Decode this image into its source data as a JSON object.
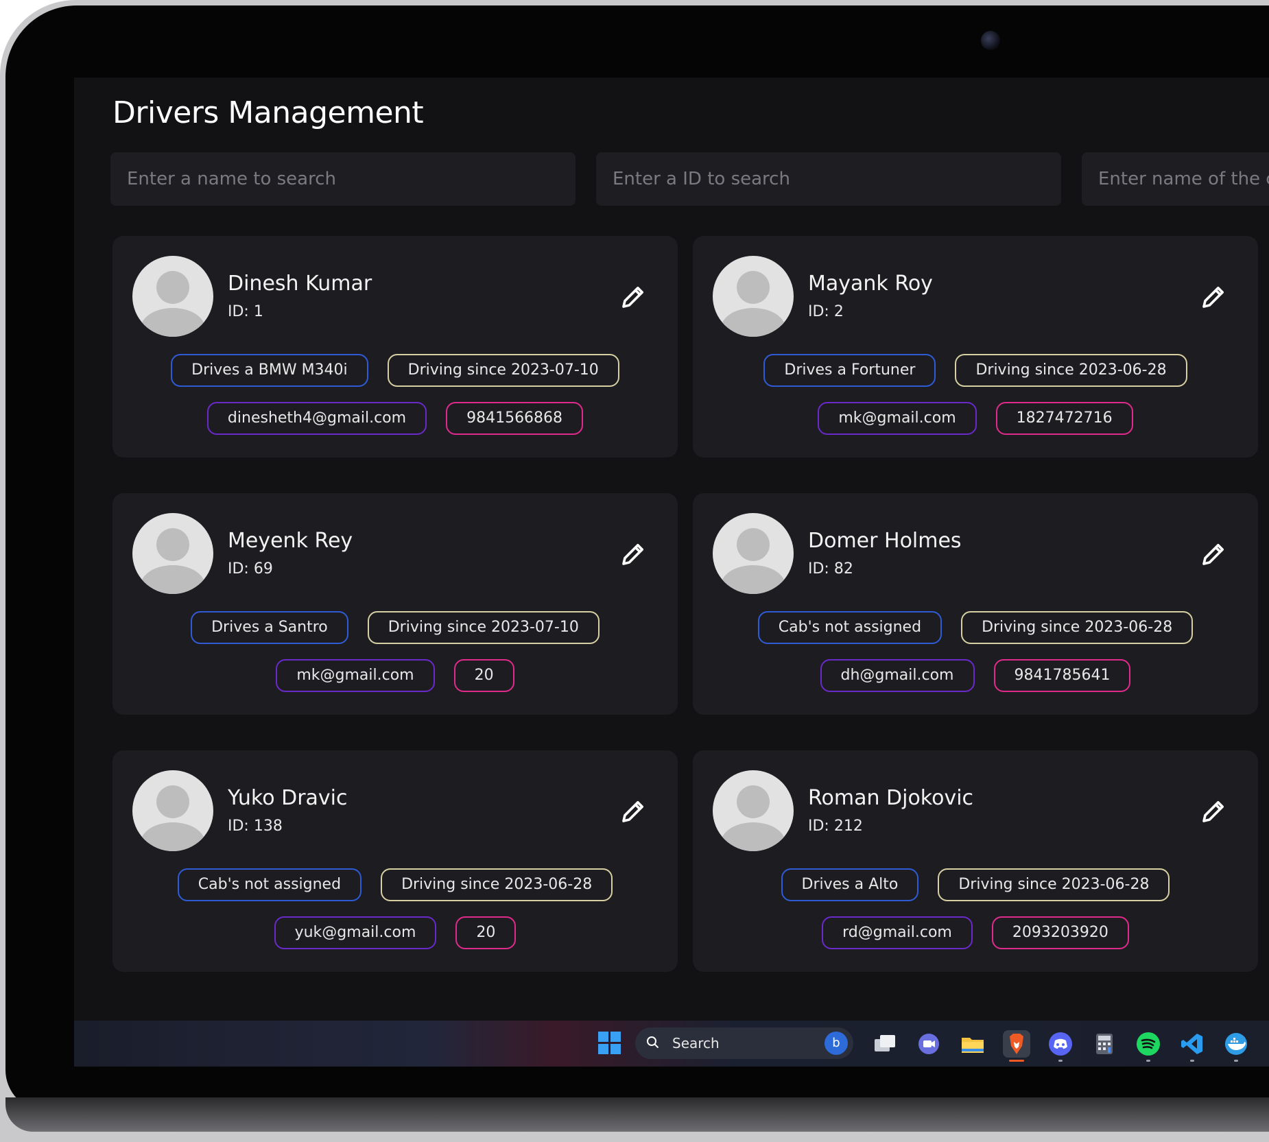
{
  "page": {
    "title": "Drivers Management"
  },
  "search": {
    "name_placeholder": "Enter a name to search",
    "id_placeholder": "Enter a ID to search",
    "cab_placeholder": "Enter name of the cab"
  },
  "drivers": [
    {
      "name": "Dinesh Kumar",
      "id": "ID: 1",
      "cab": "Drives a BMW M340i",
      "since": "Driving since 2023-07-10",
      "email": "dinesheth4@gmail.com",
      "phone": "9841566868"
    },
    {
      "name": "Mayank Roy",
      "id": "ID: 2",
      "cab": "Drives a Fortuner",
      "since": "Driving since 2023-06-28",
      "email": "mk@gmail.com",
      "phone": "1827472716"
    },
    {
      "name": "Meyenk Rey",
      "id": "ID: 69",
      "cab": "Drives a Santro",
      "since": "Driving since 2023-07-10",
      "email": "mk@gmail.com",
      "phone": "20"
    },
    {
      "name": "Domer Holmes",
      "id": "ID: 82",
      "cab": "Cab's not assigned",
      "since": "Driving since 2023-06-28",
      "email": "dh@gmail.com",
      "phone": "9841785641"
    },
    {
      "name": "Yuko Dravic",
      "id": "ID: 138",
      "cab": "Cab's not assigned",
      "since": "Driving since 2023-06-28",
      "email": "yuk@gmail.com",
      "phone": "20"
    },
    {
      "name": "Roman Djokovic",
      "id": "ID: 212",
      "cab": "Drives a Alto",
      "since": "Driving since 2023-06-28",
      "email": "rd@gmail.com",
      "phone": "2093203920"
    }
  ],
  "taskbar": {
    "search_label": "Search",
    "icons": [
      "windows-start-icon",
      "bing-icon",
      "task-view-icon",
      "teams-chat-icon",
      "file-explorer-icon",
      "brave-browser-icon",
      "discord-icon",
      "calculator-icon",
      "spotify-icon",
      "vscode-icon",
      "docker-icon"
    ]
  },
  "colors": {
    "background": "#121214",
    "card": "#1d1d21",
    "cab_border": "#2f5bd6",
    "since_border": "#d8d0a2",
    "email_border": "#6a29c9",
    "phone_border": "#e02a8c"
  }
}
